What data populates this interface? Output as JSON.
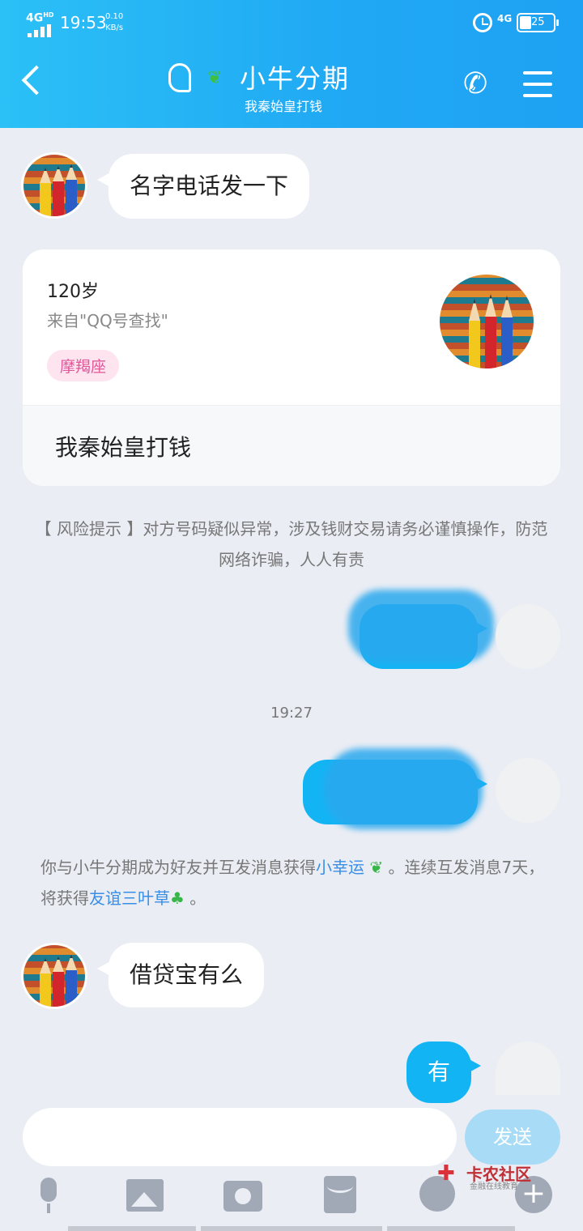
{
  "status_bar": {
    "network": "4G",
    "network_hd": "HD",
    "time": "19:53",
    "speed_value": "0.10",
    "speed_unit": "KB/s",
    "network_right": "4G",
    "battery": "25"
  },
  "header": {
    "title": "小牛分期",
    "subtitle": "我秦始皇打钱"
  },
  "messages": {
    "msg1": "名字电话发一下",
    "card": {
      "age": "120岁",
      "source": "来自\"QQ号查找\"",
      "tag": "摩羯座",
      "signature": "我秦始皇打钱"
    },
    "risk_notice": "【 风险提示 】对方号码疑似异常，涉及钱财交易请务必谨慎操作，防范网络诈骗，人人有责",
    "timestamp": "19:27",
    "system": {
      "part1": "你与小牛分期成为好友并互发消息获得",
      "link1": "小幸运",
      "part2": "。连续互发消息7天，将获得",
      "link2": "友谊三叶草",
      "part3": "。"
    },
    "msg2": "借贷宝有么",
    "msg3": "有"
  },
  "input_bar": {
    "send_label": "发送"
  },
  "watermark": {
    "name": "卡农社区",
    "sub": "金融在线教育"
  },
  "colors": {
    "header": "#20a8f4",
    "bubble_right": "#13b4f4",
    "link": "#3a8ee6"
  }
}
